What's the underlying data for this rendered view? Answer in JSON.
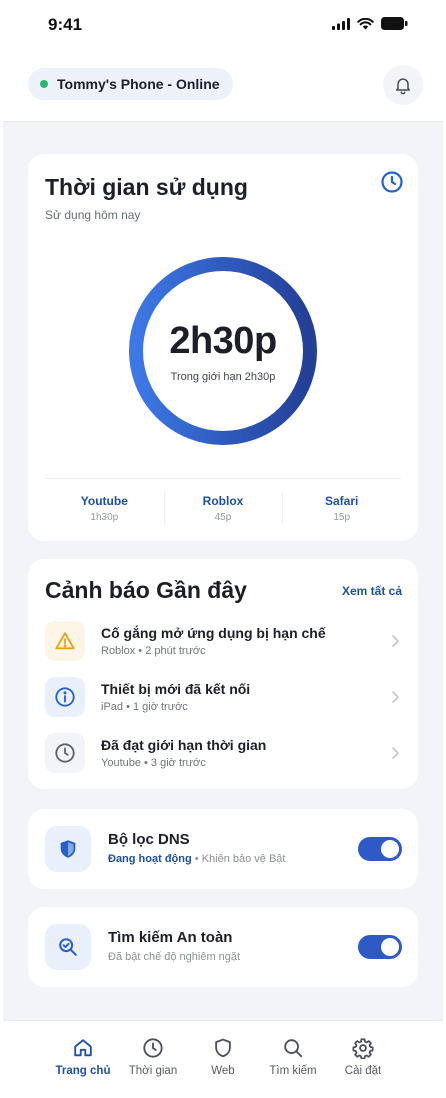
{
  "status_bar": {
    "time": "9:41"
  },
  "header": {
    "device_status": "Tommy's Phone - Online"
  },
  "usage": {
    "title": "Thời gian sử dụng",
    "subtitle": "Sử dụng hôm nay",
    "total": "2h30p",
    "limit_text": "Trong giới hạn 2h30p",
    "progress": 1.0,
    "apps": [
      {
        "name": "Youtube",
        "value": "1h30p"
      },
      {
        "name": "Roblox",
        "value": "45p"
      },
      {
        "name": "Safari",
        "value": "15p"
      }
    ]
  },
  "alerts": {
    "title": "Cảnh báo Gần đây",
    "see_all": "Xem tất cả",
    "items": [
      {
        "title": "Cố gắng mở ứng dụng bị hạn chế",
        "sub": "Roblox • 2 phút trước",
        "icon": "warning-icon"
      },
      {
        "title": "Thiết bị mới đã kết nối",
        "sub": "iPad • 1 giờ trước",
        "icon": "info-icon"
      },
      {
        "title": "Đã đạt giới hạn thời gian",
        "sub": "Youtube • 3 giờ trước",
        "icon": "clock-icon"
      }
    ]
  },
  "dns": {
    "title": "Bộ lọc DNS",
    "status": "Đang hoạt động",
    "sub": "• Khiên bảo vệ Bật",
    "enabled": true
  },
  "safe_search": {
    "title": "Tìm kiếm An toàn",
    "sub": "Đã bật chế độ nghiêm ngặt",
    "enabled": true
  },
  "tabs": [
    {
      "label": "Trang chủ",
      "icon": "home-icon",
      "active": true
    },
    {
      "label": "Thời gian",
      "icon": "clock-icon",
      "active": false
    },
    {
      "label": "Web",
      "icon": "shield-icon",
      "active": false
    },
    {
      "label": "Tìm kiếm",
      "icon": "search-icon",
      "active": false
    },
    {
      "label": "Cài đặt",
      "icon": "gear-icon",
      "active": false
    }
  ],
  "colors": {
    "primary": "#1e4fa8",
    "toggle": "#2e59c7",
    "online": "#2bb673",
    "warning": "#e8a317",
    "ring_start": "#3c78e6",
    "ring_end": "#233f96"
  }
}
